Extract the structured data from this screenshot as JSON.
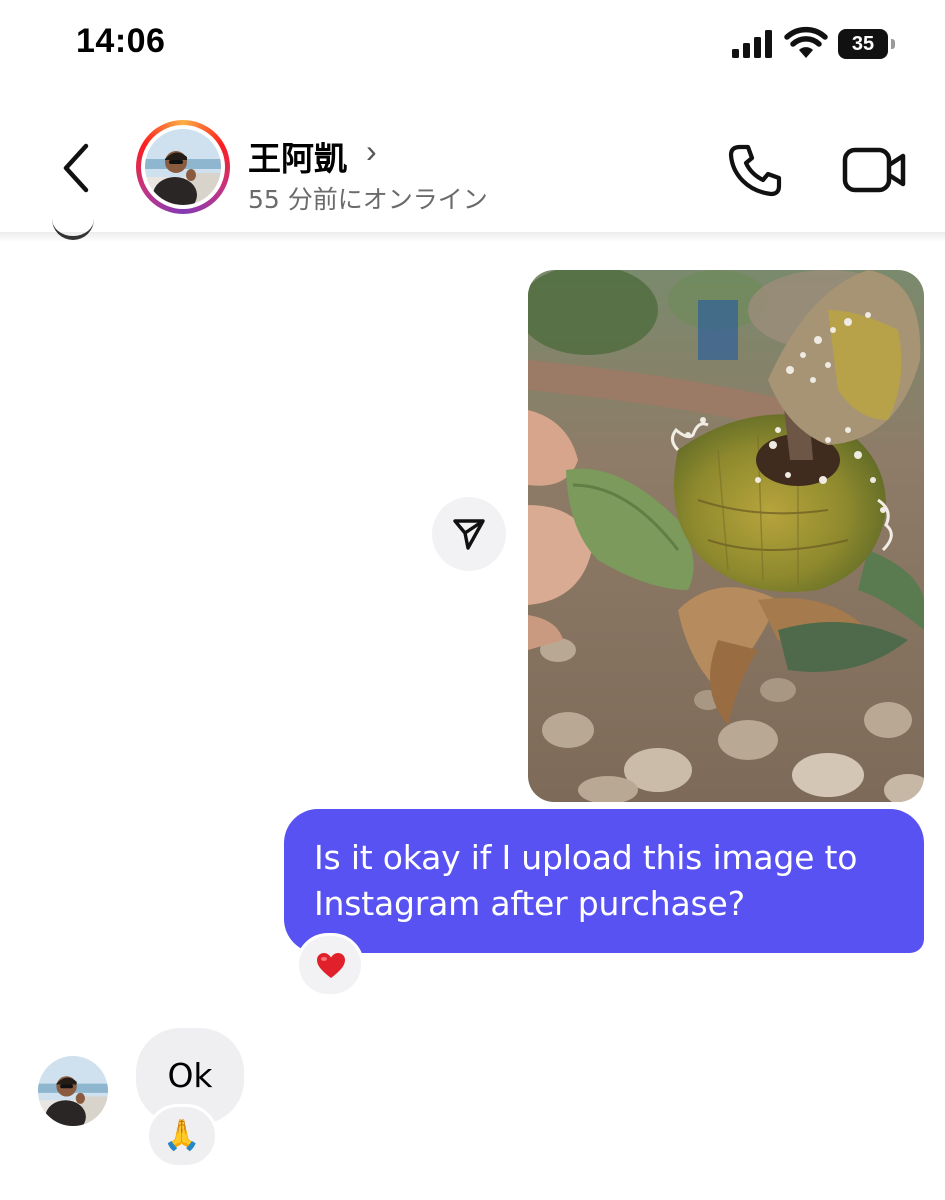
{
  "status_bar": {
    "time": "14:06",
    "battery_level": "35",
    "icons": [
      "signal-icon",
      "wifi-icon",
      "battery-icon"
    ]
  },
  "header": {
    "contact_name": "王阿凱",
    "name_chevron": "›",
    "status": "55 分前にオンライン",
    "icons": [
      "back-chevron-icon",
      "phone-icon",
      "video-camera-icon"
    ]
  },
  "thread": {
    "outgoing_text": "Is it okay if I upload this image to Instagram after purchase?",
    "outgoing_reaction": "heart-emoji",
    "incoming_text": "Ok",
    "incoming_reaction": "folded-hands-emoji",
    "photo_subject": "succulent-plant-photo",
    "share_icon": "send-icon"
  },
  "colors": {
    "outgoing_bubble": "#5852f2",
    "incoming_bubble": "#efeff1",
    "heart": "#e0202a",
    "story_ring": [
      "#fcaf45",
      "#fd1d1d",
      "#c13584",
      "#833ab4"
    ]
  }
}
